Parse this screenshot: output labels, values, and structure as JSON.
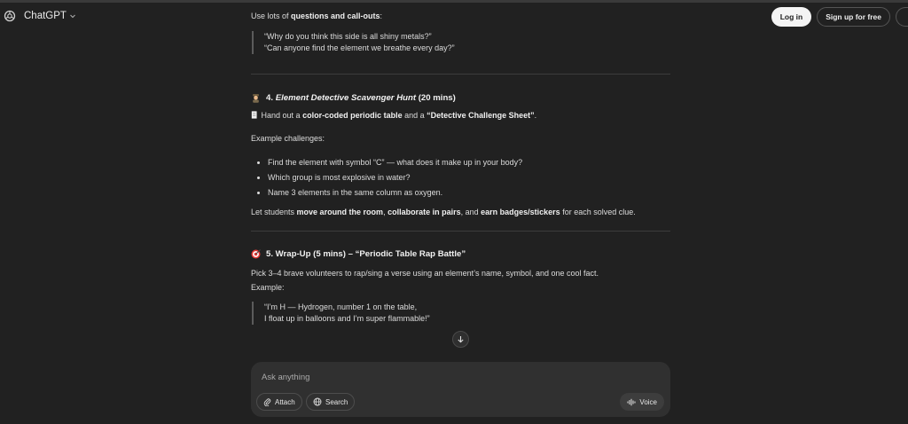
{
  "header": {
    "app_name": "ChatGPT",
    "login_label": "Log in",
    "signup_label": "Sign up for free"
  },
  "content": {
    "intro_prefix": "Use lots of ",
    "intro_bold": "questions and call-outs",
    "intro_suffix": ":",
    "quote1": [
      "“Why do you think this side is all shiny metals?”",
      "“Can anyone find the element we breathe every day?”"
    ],
    "section4": {
      "icon": "detective-emoji",
      "number": "4.",
      "title_italic": "Element Detective Scavenger Hunt",
      "title_suffix": "(20 mins)",
      "handout_icon": "page-emoji",
      "handout_prefix": "Hand out a ",
      "handout_bold1": "color-coded periodic table",
      "handout_mid": " and a ",
      "handout_bold2": "“Detective Challenge Sheet”",
      "handout_suffix": ".",
      "examples_label": "Example challenges:",
      "bullets": [
        "Find the element with symbol “C” — what does it make up in your body?",
        "Which group is most explosive in water?",
        "Name 3 elements in the same column as oxygen."
      ],
      "closing_prefix": "Let students ",
      "closing_bold1": "move around the room",
      "closing_sep": ", ",
      "closing_bold2": "collaborate in pairs",
      "closing_and": ", and ",
      "closing_bold3": "earn badges/stickers",
      "closing_suffix": " for each solved clue."
    },
    "section5": {
      "icon": "target-emoji",
      "title": "5. Wrap-Up (5 mins) – “Periodic Table Rap Battle”",
      "body": "Pick 3–4 brave volunteers to rap/sing a verse using an element’s name, symbol, and one cool fact.",
      "example_label": "Example:",
      "quote": [
        "“I’m H — Hydrogen, number 1 on the table,",
        "I float up in balloons and I’m super flammable!”"
      ]
    }
  },
  "composer": {
    "placeholder": "Ask anything",
    "attach_label": "Attach",
    "search_label": "Search",
    "voice_label": "Voice"
  }
}
